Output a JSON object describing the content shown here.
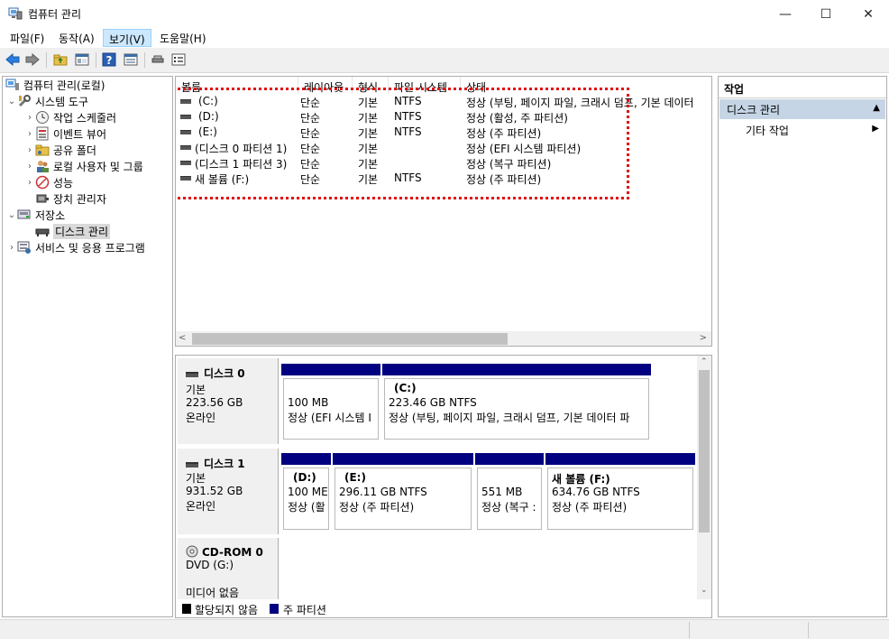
{
  "window": {
    "title": "컴퓨터 관리"
  },
  "menu": [
    {
      "label": "파일(F)"
    },
    {
      "label": "동작(A)"
    },
    {
      "label": "보기(V)"
    },
    {
      "label": "도움말(H)"
    }
  ],
  "toolbar": {
    "buttons": [
      "back-icon",
      "forward-icon",
      "up-folder-icon",
      "show-hide-tree-icon",
      "help-icon",
      "view-icon",
      "connect-icon",
      "properties-icon"
    ]
  },
  "tree": {
    "root": "컴퓨터 관리(로컬)",
    "system_tools": "시스템 도구",
    "task_scheduler": "작업 스케줄러",
    "event_viewer": "이벤트 뷰어",
    "shared_folders": "공유 폴더",
    "local_users": "로컬 사용자 및 그룹",
    "performance": "성능",
    "device_manager": "장치 관리자",
    "storage": "저장소",
    "disk_management": "디스크 관리",
    "services": "서비스 및 응용 프로그램"
  },
  "volumes": {
    "headers": [
      "볼륨",
      "레이아웃",
      "형식",
      "파일 시스템",
      "상태"
    ],
    "rows": [
      {
        "name": "(C:)",
        "layout": "단순",
        "type": "기본",
        "fs": "NTFS",
        "status": "정상 (부팅, 페이지 파일, 크래시 덤프, 기본 데이터"
      },
      {
        "name": "(D:)",
        "layout": "단순",
        "type": "기본",
        "fs": "NTFS",
        "status": "정상 (활성, 주 파티션)"
      },
      {
        "name": "(E:)",
        "layout": "단순",
        "type": "기본",
        "fs": "NTFS",
        "status": "정상 (주 파티션)"
      },
      {
        "name": "(디스크 0 파티션 1)",
        "layout": "단순",
        "type": "기본",
        "fs": "",
        "status": "정상 (EFI 시스템 파티션)"
      },
      {
        "name": "(디스크 1 파티션 3)",
        "layout": "단순",
        "type": "기본",
        "fs": "",
        "status": "정상 (복구 파티션)"
      },
      {
        "name": "새 볼륨 (F:)",
        "layout": "단순",
        "type": "기본",
        "fs": "NTFS",
        "status": "정상 (주 파티션)"
      }
    ]
  },
  "disks": {
    "disk0": {
      "name": "디스크 0",
      "type": "기본",
      "size": "223.56 GB",
      "state": "온라인",
      "p1": {
        "size": "100 MB",
        "status": "정상 (EFI 시스템 I"
      },
      "p2": {
        "name": "(C:)",
        "size": "223.46 GB NTFS",
        "status": "정상 (부팅, 페이지 파일, 크래시 덤프, 기본 데이터 파"
      }
    },
    "disk1": {
      "name": "디스크 1",
      "type": "기본",
      "size": "931.52 GB",
      "state": "온라인",
      "p1": {
        "name": "(D:)",
        "size": "100 ME",
        "status": "정상 (활"
      },
      "p2": {
        "name": "(E:)",
        "size": "296.11 GB NTFS",
        "status": "정상 (주 파티션)"
      },
      "p3": {
        "size": "551 MB",
        "status": "정상 (복구 :"
      },
      "p4": {
        "name": "새 볼륨  (F:)",
        "size": "634.76 GB NTFS",
        "status": "정상 (주 파티션)"
      }
    },
    "cdrom": {
      "name": "CD-ROM 0",
      "drive": "DVD (G:)",
      "state": "미디어 없음"
    }
  },
  "legend": {
    "unallocated": "할당되지 않음",
    "primary": "주 파티션"
  },
  "actions": {
    "title": "작업",
    "group": "디스크 관리",
    "other": "기타 작업"
  },
  "colors": {
    "partition_bar": "#000080",
    "selection_red": "#e01010",
    "actions_group_bg": "#c5d5e5"
  }
}
